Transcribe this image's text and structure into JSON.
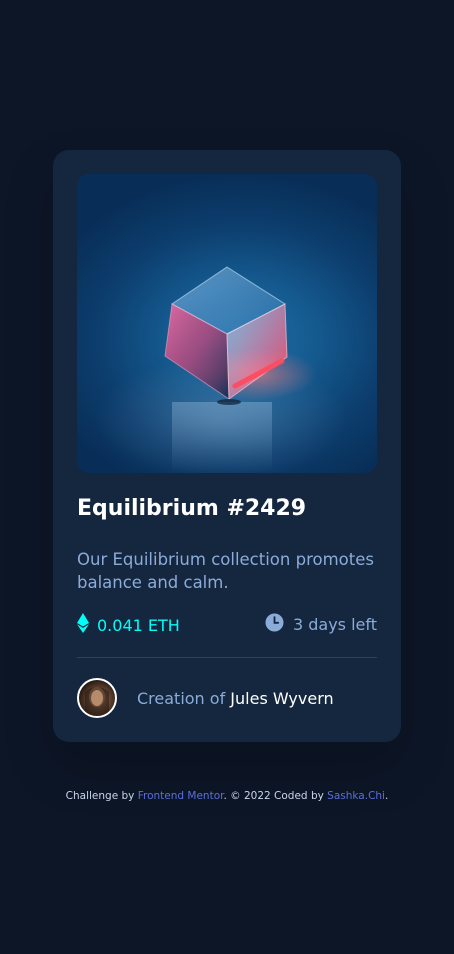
{
  "card": {
    "image_alt": "Equilibrium",
    "title": "Equilibrium #2429",
    "description": "Our Equilibrium collection promotes balance and calm.",
    "price": "0.041 ETH",
    "time_left": "3 days left",
    "creator_prefix": "Creation of ",
    "creator_name": "Jules Wyvern"
  },
  "footer": {
    "text_1": "Challenge by ",
    "link_1": "Frontend Mentor",
    "text_2": ". © 2022 Coded by ",
    "link_2": "Sashka.Chi",
    "text_3": "."
  },
  "colors": {
    "background": "#0d1627",
    "card": "#15263f",
    "accent_cyan": "#00fff8",
    "soft_blue": "#8bacd9",
    "link": "#5a6fdc",
    "divider": "#2e405a"
  },
  "icons": {
    "price": "ethereum-icon",
    "time": "clock-icon"
  }
}
